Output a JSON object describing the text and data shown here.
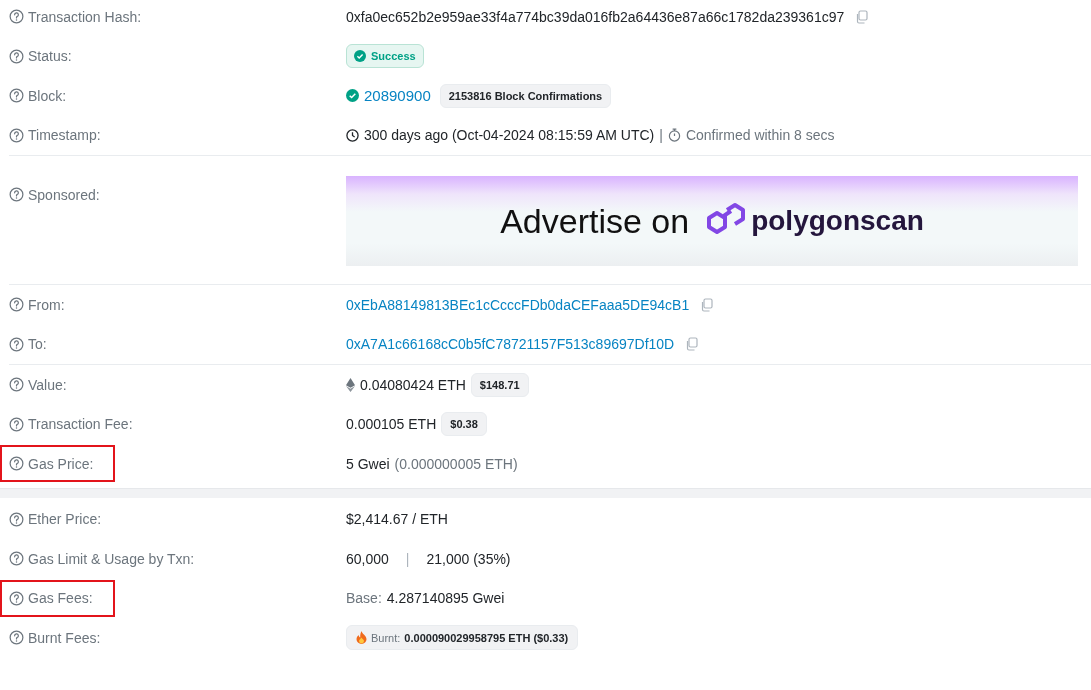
{
  "sections": [
    {
      "groups": [
        {
          "rows": [
            {
              "kind": "hash",
              "label": "Transaction Hash:",
              "highlighted": false,
              "text": "0xfa0ec652b2e959ae33f4a774bc39da016fb2a64436e87a66c1782da239361c97"
            },
            {
              "kind": "status",
              "label": "Status:",
              "highlighted": false,
              "badge": "Success"
            },
            {
              "kind": "block",
              "label": "Block:",
              "highlighted": false,
              "link": "20890900",
              "badge": "2153816 Block Confirmations"
            },
            {
              "kind": "timestamp",
              "label": "Timestamp:",
              "highlighted": false,
              "text": "300 days ago (Oct-04-2024 08:15:59 AM UTC)",
              "separator": "|",
              "note": "Confirmed within 8 secs"
            }
          ]
        },
        {
          "rows": [
            {
              "kind": "ad",
              "label": "Sponsored:",
              "highlighted": false,
              "headline": "Advertise on",
              "brand": "polygonscan"
            }
          ]
        },
        {
          "rows": [
            {
              "kind": "address",
              "label": "From:",
              "highlighted": false,
              "link": "0xEbA88149813BEc1cCcccFDb0daCEFaaa5DE94cB1"
            },
            {
              "kind": "address",
              "label": "To:",
              "highlighted": false,
              "link": "0xA7A1c66168cC0b5fC78721157F513c89697Df10D"
            }
          ]
        },
        {
          "rows": [
            {
              "kind": "value",
              "label": "Value:",
              "highlighted": false,
              "text": "0.04080424 ETH",
              "badge": "$148.71"
            },
            {
              "kind": "fee",
              "label": "Transaction Fee:",
              "highlighted": false,
              "text": "0.000105 ETH",
              "badge": "$0.38"
            },
            {
              "kind": "price",
              "label": "Gas Price:",
              "highlighted": true,
              "text": "5 Gwei",
              "muted": "(0.000000005 ETH)"
            }
          ]
        }
      ]
    },
    {
      "groups": [
        {
          "rows": [
            {
              "kind": "plain",
              "label": "Ether Price:",
              "highlighted": false,
              "text": "$2,414.67 / ETH"
            },
            {
              "kind": "limit",
              "label": "Gas Limit & Usage by Txn:",
              "highlighted": false,
              "text": "60,000",
              "separator": "|",
              "usage": "21,000 (35%)"
            },
            {
              "kind": "base",
              "label": "Gas Fees:",
              "highlighted": true,
              "prefix": "Base:",
              "text": "4.287140895 Gwei"
            },
            {
              "kind": "burnt",
              "label": "Burnt Fees:",
              "highlighted": false,
              "prefix": "Burnt:",
              "text": "0.000090029958795 ETH ($0.33)"
            }
          ]
        }
      ]
    }
  ]
}
